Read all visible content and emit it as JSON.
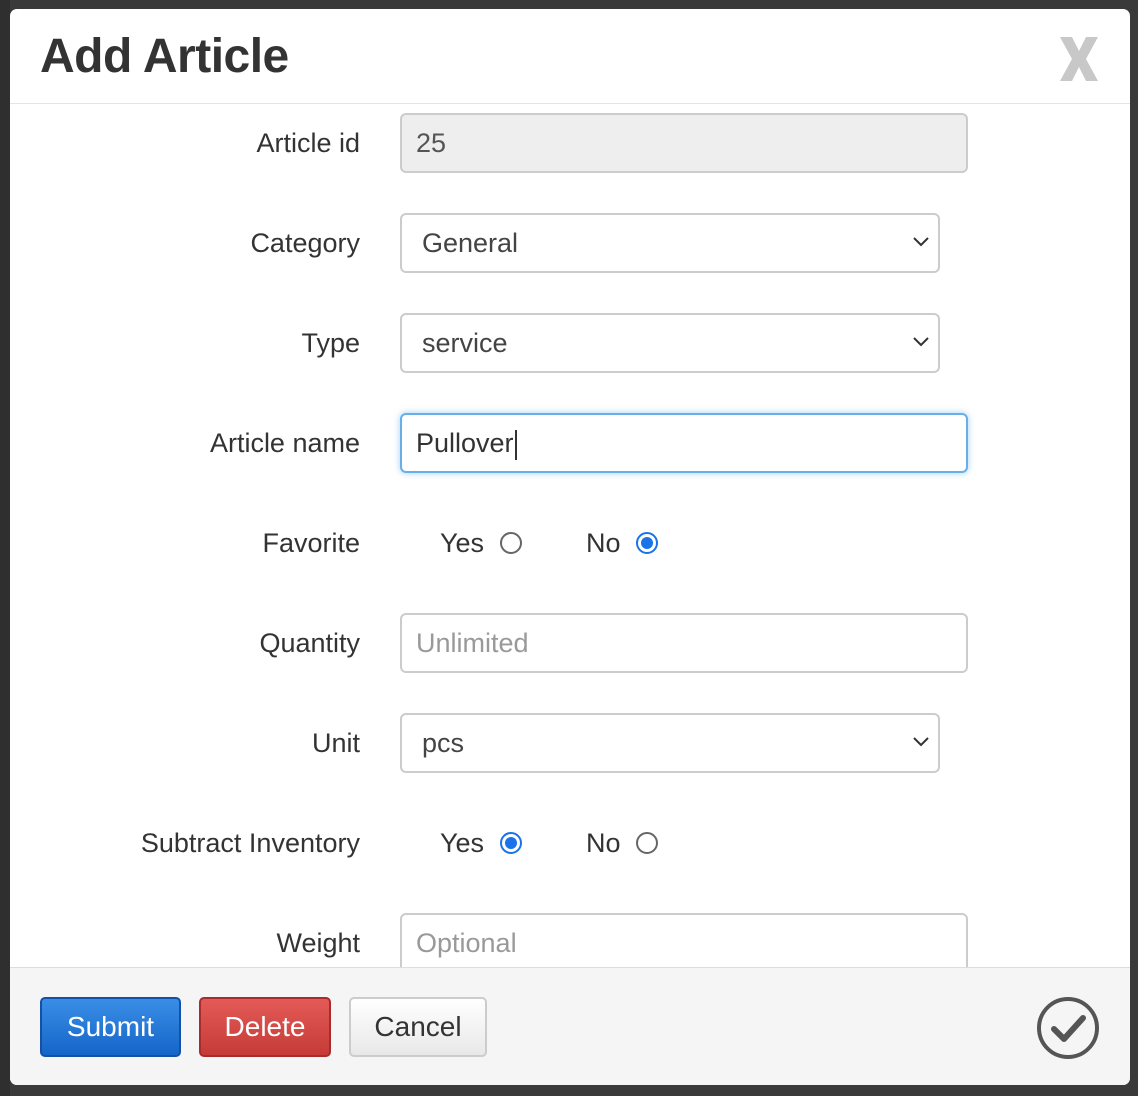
{
  "dialog": {
    "title": "Add Article",
    "close_label": "X"
  },
  "form": {
    "article_id": {
      "label": "Article id",
      "value": "25"
    },
    "category": {
      "label": "Category",
      "selected": "General"
    },
    "type": {
      "label": "Type",
      "selected": "service"
    },
    "article_name": {
      "label": "Article name",
      "value": "Pullover"
    },
    "favorite": {
      "label": "Favorite",
      "yes_label": "Yes",
      "no_label": "No",
      "selected": "No"
    },
    "quantity": {
      "label": "Quantity",
      "placeholder": "Unlimited"
    },
    "unit": {
      "label": "Unit",
      "selected": "pcs"
    },
    "subtract_inventory": {
      "label": "Subtract Inventory",
      "yes_label": "Yes",
      "no_label": "No",
      "selected": "Yes"
    },
    "weight": {
      "label": "Weight",
      "placeholder": "Optional"
    }
  },
  "footer": {
    "submit_label": "Submit",
    "delete_label": "Delete",
    "cancel_label": "Cancel"
  },
  "colors": {
    "primary": "#1a73e8",
    "danger": "#d9534f",
    "focus": "#66afe9"
  },
  "icons": [
    "close-icon",
    "chevron-down-icon",
    "checkmark-circle-icon"
  ]
}
